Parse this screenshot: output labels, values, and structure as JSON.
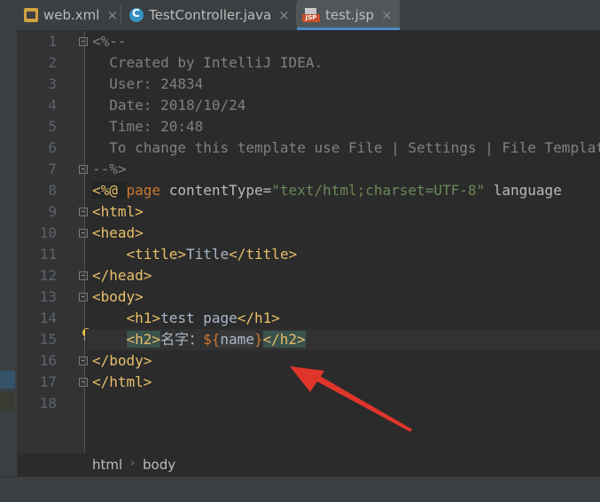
{
  "tabs": [
    {
      "label": "web.xml",
      "icon": "xml-file-icon",
      "close": "×",
      "active": false
    },
    {
      "label": "TestController.java",
      "icon": "java-class-icon",
      "close": "×",
      "active": false
    },
    {
      "label": "test.jsp",
      "icon": "jsp-file-icon",
      "badge": "JSP",
      "close": "×",
      "active": true
    }
  ],
  "line_numbers": [
    "1",
    "2",
    "3",
    "4",
    "5",
    "6",
    "7",
    "8",
    "9",
    "10",
    "11",
    "12",
    "13",
    "14",
    "15",
    "16",
    "17",
    "18"
  ],
  "code": {
    "l1": "<%--",
    "l2": "  Created by IntelliJ IDEA.",
    "l3": "  User: 24834",
    "l4": "  Date: 2018/10/24",
    "l5": "  Time: 20:48",
    "l6": "  To change this template use File | Settings | File Templates.",
    "l7": "--%>",
    "l8_open": "<%@ ",
    "l8_dir": "page",
    "l8_attr1": " contentType",
    "l8_eq": "=",
    "l8_val1": "\"text/html;charset=UTF-8\"",
    "l8_attr2": " language",
    "l9": "<html>",
    "l10": "<head>",
    "l11_indent": "    ",
    "l11_open": "<title>",
    "l11_text": "Title",
    "l11_close": "</title>",
    "l12": "</head>",
    "l13": "<body>",
    "l14_indent": "    ",
    "l14_open": "<h1>",
    "l14_text": "test page",
    "l14_close": "</h1>",
    "l15_indent": "    ",
    "l15_open": "<h2>",
    "l15_text": "名字：",
    "l15_el_open": "${",
    "l15_el_var": "name",
    "l15_el_close": "}",
    "l15_close": "</h2>",
    "l16": "</body>",
    "l17": "</html>"
  },
  "breadcrumb": {
    "items": [
      "html",
      "body"
    ],
    "separator": "›"
  },
  "colors": {
    "arrow": "#e0352b",
    "accent": "#4a88c7"
  }
}
